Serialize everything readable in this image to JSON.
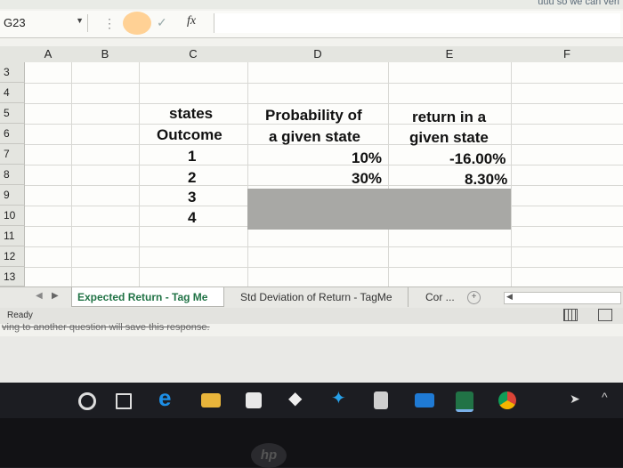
{
  "formula_bar": {
    "name_box": "G23",
    "fx_label": "fx"
  },
  "columns": [
    "A",
    "B",
    "C",
    "D",
    "E",
    "F"
  ],
  "rows": [
    "3",
    "4",
    "5",
    "6",
    "7",
    "8",
    "9",
    "10",
    "11",
    "12",
    "13"
  ],
  "cells": {
    "c5": "states",
    "c6": "Outcome",
    "c7": "1",
    "c8": "2",
    "c9": "3",
    "c10": "4",
    "d5": "Probability of",
    "d6": "a given state",
    "d7": "10%",
    "d8": "30%",
    "e5": "return in a",
    "e6": "given state",
    "e7": "-16.00%",
    "e8": "8.30%"
  },
  "sheet_tabs": [
    "Expected Return - Tag Me",
    "Std Deviation of Return - TagMe",
    "Cor ..."
  ],
  "status": "Ready",
  "message": "ving to another question will save this response.",
  "top_hint": "uuu so we can veri",
  "taskbar_icons": [
    "cortana-icon",
    "task-view-icon",
    "edge-icon",
    "file-explorer-icon",
    "store-icon",
    "dropbox-icon",
    "app-icon",
    "calculator-icon",
    "mail-icon",
    "excel-icon",
    "chrome-icon"
  ],
  "colors": {
    "excel_green": "#217346",
    "shade": "#a8a8a5"
  }
}
